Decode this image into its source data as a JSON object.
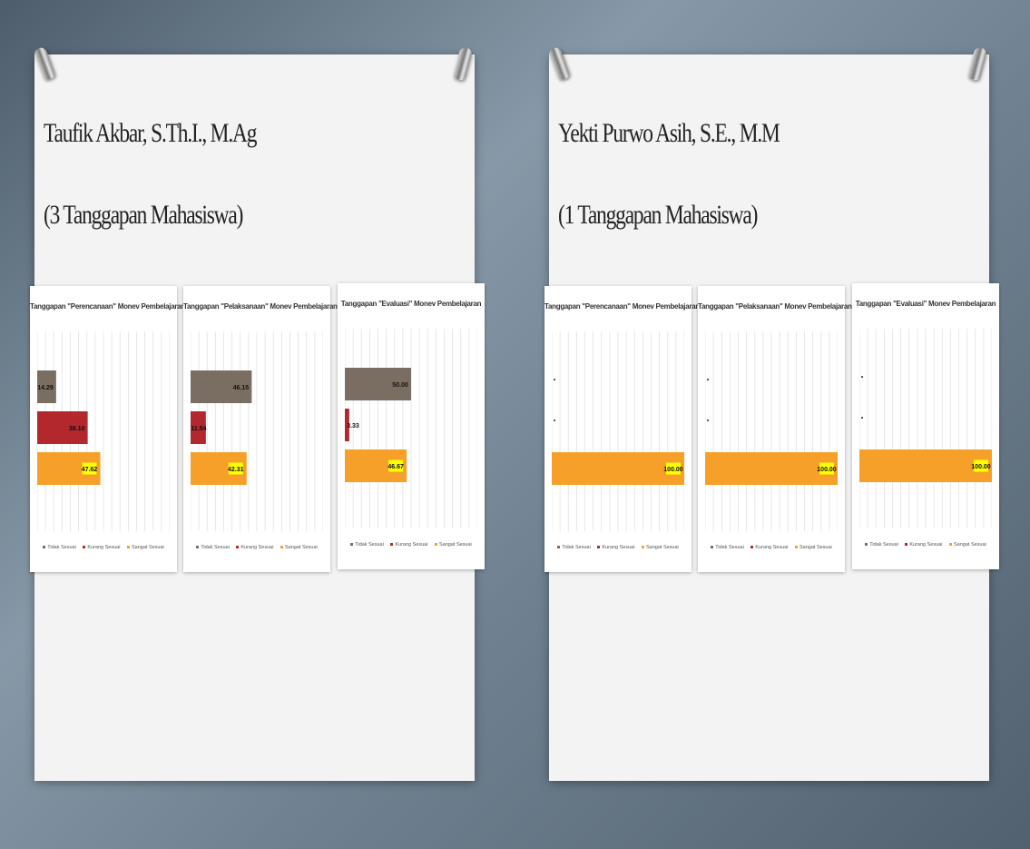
{
  "colors": {
    "tidak_sesuai": "#7a6e63",
    "kurang_sesuai": "#b3282d",
    "sangat_sesuai": "#f7a029",
    "label_bg": "#ffff00"
  },
  "slides": [
    {
      "title": "Taufik Akbar, S.Th.I., M.Ag",
      "subtitle": "(3 Tanggapan Mahasiswa)"
    },
    {
      "title": "Yekti Purwo Asih, S.E., M.M",
      "subtitle": "(1 Tanggapan Mahasiswa)"
    }
  ],
  "chart_data": [
    {
      "type": "bar",
      "title": "Tanggapan \"Perencanaan\" Monev Pembelajaran",
      "categories": [
        "Tidak Sesuai",
        "Kurang Sesuai",
        "Sangat Sesuai"
      ],
      "values": [
        14.29,
        38.1,
        47.62
      ],
      "xlim": [
        0,
        100
      ]
    },
    {
      "type": "bar",
      "title": "Tanggapan \"Pelaksanaan\" Monev Pembelajaran",
      "categories": [
        "Tidak Sesuai",
        "Kurang Sesuai",
        "Sangat Sesuai"
      ],
      "values": [
        46.15,
        11.54,
        42.31
      ],
      "xlim": [
        0,
        100
      ]
    },
    {
      "type": "bar",
      "title": "Tanggapan \"Evaluasi\" Monev Pembelajaran",
      "categories": [
        "Tidak Sesuai",
        "Kurang Sesuai",
        "Sangat Sesuai"
      ],
      "values": [
        50.0,
        3.33,
        46.67
      ],
      "xlim": [
        0,
        100
      ]
    },
    {
      "type": "bar",
      "title": "Tanggapan \"Perencanaan\" Monev Pembelajaran",
      "categories": [
        "Tidak Sesuai",
        "Kurang Sesuai",
        "Sangat Sesuai"
      ],
      "values": [
        0,
        0,
        100.0
      ],
      "xlim": [
        0,
        100
      ]
    },
    {
      "type": "bar",
      "title": "Tanggapan \"Pelaksanaan\" Monev Pembelajaran",
      "categories": [
        "Tidak Sesuai",
        "Kurang Sesuai",
        "Sangat Sesuai"
      ],
      "values": [
        0,
        0,
        100.0
      ],
      "xlim": [
        0,
        100
      ]
    },
    {
      "type": "bar",
      "title": "Tanggapan \"Evaluasi\" Monev Pembelajaran",
      "categories": [
        "Tidak Sesuai",
        "Kurang Sesuai",
        "Sangat Sesuai"
      ],
      "values": [
        0,
        0,
        100.0
      ],
      "xlim": [
        0,
        100
      ]
    }
  ]
}
